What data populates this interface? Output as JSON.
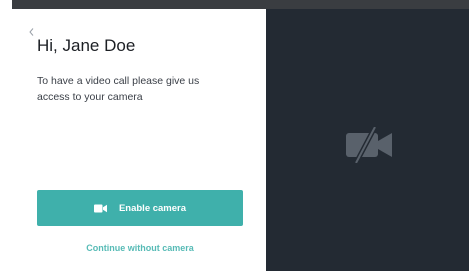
{
  "header": {
    "greeting": "Hi, Jane Doe"
  },
  "content": {
    "description": "To have a video call please give us access to your camera"
  },
  "actions": {
    "enable_camera_label": "Enable camera",
    "continue_without_camera_label": "Continue without camera"
  },
  "icons": {
    "back": "chevron-left-icon",
    "enable_camera": "video-camera-icon",
    "preview_status": "camera-off-icon"
  },
  "colors": {
    "accent": "#3fb0ab",
    "link": "#57bbb6",
    "preview_background": "#232a33",
    "title_text": "#1c1f24"
  }
}
